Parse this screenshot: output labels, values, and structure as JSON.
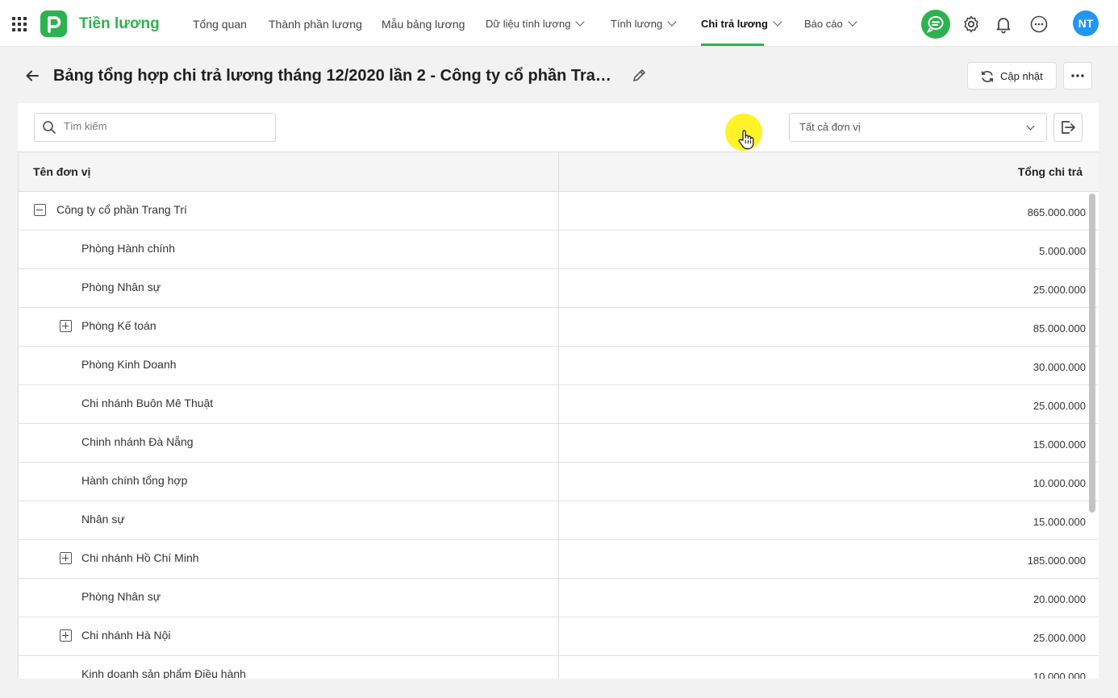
{
  "app": {
    "name": "Tiền lương",
    "user_initials": "NT"
  },
  "nav": [
    {
      "label": "Tổng quan",
      "dropdown": false
    },
    {
      "label": "Thành phần lương",
      "dropdown": false
    },
    {
      "label": "Mẫu bảng lương",
      "dropdown": false
    },
    {
      "label": "Dữ liệu tính lương",
      "dropdown": true
    },
    {
      "label": "Tính lương",
      "dropdown": true
    },
    {
      "label": "Chi trả lương",
      "dropdown": true,
      "active": true
    },
    {
      "label": "Báo cáo",
      "dropdown": true
    }
  ],
  "page": {
    "title": "Bảng tổng hợp chi trả lương tháng 12/2020 lần 2 - Công ty cổ phần Trang...",
    "update_label": "Cập nhật"
  },
  "search": {
    "placeholder": "Tìm kiếm",
    "value": ""
  },
  "filter": {
    "selected": "Tất cả đơn vị"
  },
  "table": {
    "columns": [
      "Tên đơn vị",
      "Tổng chi trả"
    ],
    "rows": [
      {
        "name": "Công ty cổ phần Trang Trí",
        "total": "865.000.000",
        "level": 0,
        "toggle": "collapse"
      },
      {
        "name": "Phòng Hành chính",
        "total": "5.000.000",
        "level": 1,
        "toggle": "none"
      },
      {
        "name": "Phòng Nhân sự",
        "total": "25.000.000",
        "level": 1,
        "toggle": "none"
      },
      {
        "name": "Phòng Kế toán",
        "total": "85.000.000",
        "level": 1,
        "toggle": "expand"
      },
      {
        "name": "Phòng Kinh Doanh",
        "total": "30.000.000",
        "level": 1,
        "toggle": "none"
      },
      {
        "name": "Chi nhánh Buôn Mê Thuật",
        "total": "25.000.000",
        "level": 1,
        "toggle": "none"
      },
      {
        "name": "Chinh nhánh Đà Nẵng",
        "total": "15.000.000",
        "level": 1,
        "toggle": "none"
      },
      {
        "name": "Hành chính tổng hợp",
        "total": "10.000.000",
        "level": 1,
        "toggle": "none"
      },
      {
        "name": "Nhân sự",
        "total": "15.000.000",
        "level": 1,
        "toggle": "none"
      },
      {
        "name": "Chi nhánh Hồ Chí Minh",
        "total": "185.000.000",
        "level": 1,
        "toggle": "expand"
      },
      {
        "name": "Phòng Nhân sự",
        "total": "20.000.000",
        "level": 1,
        "toggle": "none"
      },
      {
        "name": "Chi nhánh Hà Nội",
        "total": "25.000.000",
        "level": 1,
        "toggle": "expand"
      },
      {
        "name": "Kinh doanh sản phẩm Điều hành",
        "total": "10.000.000",
        "level": 1,
        "toggle": "none"
      }
    ]
  },
  "colors": {
    "accent": "#2eb24f",
    "avatar": "#2196f3",
    "cursor_highlight": "#fff000"
  }
}
